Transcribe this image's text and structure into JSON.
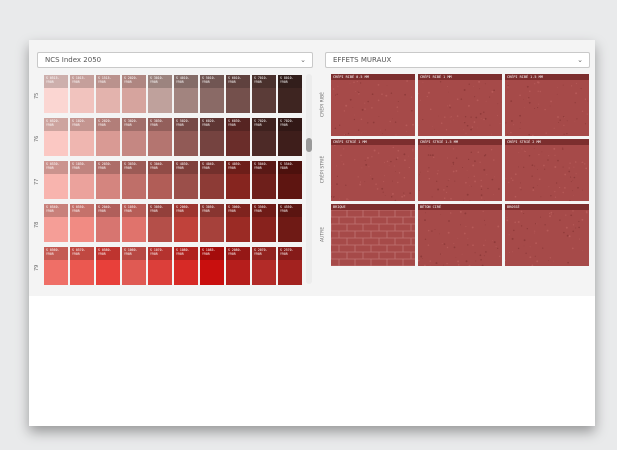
{
  "left_select": {
    "value": "NCS Index 2050"
  },
  "right_select": {
    "value": "EFFETS MURAUX"
  },
  "rows": [
    {
      "label": "75",
      "swatches": [
        {
          "code": "S 0515-\nY90R",
          "color": "#fbd6d2"
        },
        {
          "code": "S 1015-\nY90R",
          "color": "#f1c3be"
        },
        {
          "code": "S 1515-\nY90R",
          "color": "#e3b3ad"
        },
        {
          "code": "S 2020-\nY90R",
          "color": "#d6a49e"
        },
        {
          "code": "S 3010-\nY90R",
          "color": "#bfa19c"
        },
        {
          "code": "S 4010-\nY90R",
          "color": "#a2847f"
        },
        {
          "code": "S 5010-\nY90R",
          "color": "#8a6a66"
        },
        {
          "code": "S 6010-\nY90R",
          "color": "#74504c"
        },
        {
          "code": "S 7010-\nY90R",
          "color": "#5b3c38"
        },
        {
          "code": "S 8010-\nY90R",
          "color": "#3e2521"
        }
      ]
    },
    {
      "label": "76",
      "swatches": [
        {
          "code": "S 0520-\nY90R",
          "color": "#fbc8c3"
        },
        {
          "code": "S 1020-\nY90R",
          "color": "#efb6b0"
        },
        {
          "code": "S 2020-\nY90R",
          "color": "#d99a94"
        },
        {
          "code": "S 3020-\nY90R",
          "color": "#c58782"
        },
        {
          "code": "S 3030-\nY90R",
          "color": "#b47570"
        },
        {
          "code": "S 5020-\nY90R",
          "color": "#915a56"
        },
        {
          "code": "S 6020-\nY90R",
          "color": "#754340"
        },
        {
          "code": "S 6030-\nY90R",
          "color": "#6a2d2a"
        },
        {
          "code": "S 7020-\nY90R",
          "color": "#4d2a27"
        },
        {
          "code": "S 7020-\nY90R",
          "color": "#3e1e1b"
        }
      ]
    },
    {
      "label": "77",
      "swatches": [
        {
          "code": "S 0530-\nY90R",
          "color": "#f8b4ae"
        },
        {
          "code": "S 1030-\nY90R",
          "color": "#eba29c"
        },
        {
          "code": "S 2030-\nY90R",
          "color": "#d4857f"
        },
        {
          "code": "S 3030-\nY90R",
          "color": "#bf6f69"
        },
        {
          "code": "S 3040-\nY90R",
          "color": "#b15d57"
        },
        {
          "code": "S 4030-\nY90R",
          "color": "#9b4f4a"
        },
        {
          "code": "S 4040-\nY90R",
          "color": "#8d3b36"
        },
        {
          "code": "S 4050-\nY90R",
          "color": "#86251f"
        },
        {
          "code": "S 5040-\nY90R",
          "color": "#6e1f1b"
        },
        {
          "code": "S 5540-\nY80R",
          "color": "#5e1511"
        }
      ]
    },
    {
      "label": "78",
      "swatches": [
        {
          "code": "S 0540-\nY90R",
          "color": "#f59e97"
        },
        {
          "code": "S 0550-\nY90R",
          "color": "#f18b83"
        },
        {
          "code": "S 2040-\nY90R",
          "color": "#d77570"
        },
        {
          "code": "S 1050-\nY90R",
          "color": "#e0736c"
        },
        {
          "code": "S 3050-\nY90R",
          "color": "#b44f49"
        },
        {
          "code": "S 2060-\nY90R",
          "color": "#c0423b"
        },
        {
          "code": "S 3050-\nY90R",
          "color": "#a6413b"
        },
        {
          "code": "S 3060-\nY90R",
          "color": "#9b2b25"
        },
        {
          "code": "S 3560-\nY90R",
          "color": "#88221d"
        },
        {
          "code": "S 4550-\nY90R",
          "color": "#6f1a15"
        }
      ]
    },
    {
      "label": "79",
      "swatches": [
        {
          "code": "S 0560-\nY90R",
          "color": "#ef6f67"
        },
        {
          "code": "S 0570-\nY90R",
          "color": "#eb5850"
        },
        {
          "code": "S 0580-\nY90R",
          "color": "#e8403a"
        },
        {
          "code": "S 1060-\nY90R",
          "color": "#e05a53"
        },
        {
          "code": "S 1070-\nY90R",
          "color": "#dc3f3a"
        },
        {
          "code": "S 1080-\nY90R",
          "color": "#d72a26"
        },
        {
          "code": "S 1085-\nY90R",
          "color": "#c90f0e"
        },
        {
          "code": "S 2080-\nY90R",
          "color": "#b61e1c"
        },
        {
          "code": "S 2070-\nY90R",
          "color": "#b32b28"
        },
        {
          "code": "S 2570-\nY90R",
          "color": "#a3221f"
        }
      ]
    }
  ],
  "categories": [
    {
      "label": "CRÉPI RIBÉ",
      "items": [
        "CRÉPI RIBÉ 0.5 MM",
        "CRÉPI RIBÉ 1 MM",
        "CRÉPI RIBÉ 1.5 MM"
      ]
    },
    {
      "label": "CRÉPI STRIÉ",
      "items": [
        "CRÉPI STRIÉ 1 MM",
        "CRÉPI STRIÉ 1.5 MM",
        "CRÉPI STRIÉ 2 MM"
      ]
    },
    {
      "label": "AUTRE",
      "items": [
        "BRIQUE",
        "BÉTON CIRÉ",
        "BROSSÉ"
      ]
    }
  ],
  "colors": {
    "texture_base": "#a64a49",
    "texture_label": "#7c2e2e"
  },
  "icons": {
    "select_chevron": "chevron-down-icon"
  }
}
